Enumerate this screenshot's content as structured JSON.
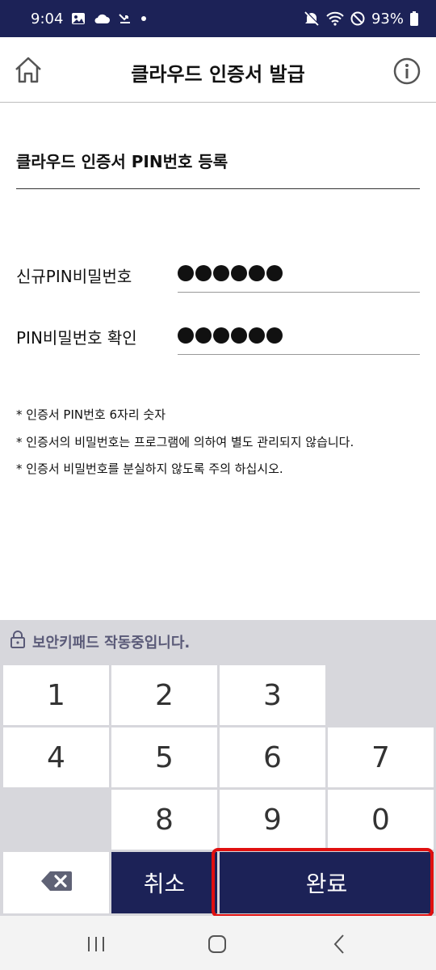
{
  "status_bar": {
    "time": "9:04",
    "battery": "93%",
    "left_icons": [
      "image-icon",
      "cloud-icon",
      "missed-call-icon",
      "dot-icon"
    ],
    "right_icons": [
      "mute-icon",
      "wifi-icon",
      "do-not-disturb-icon",
      "battery-icon"
    ]
  },
  "header": {
    "title": "클라우드 인증서 발급",
    "left_icon": "home-icon",
    "right_icon": "info-icon"
  },
  "section": {
    "title": "클라우드 인증서 PIN번호 등록"
  },
  "form": {
    "new_pin_label": "신규PIN비밀번호",
    "new_pin_dots": 6,
    "confirm_pin_label": "PIN비밀번호 확인",
    "confirm_pin_dots": 6
  },
  "notes": [
    "* 인증서 PIN번호 6자리 숫자",
    "* 인증서의 비밀번호는 프로그램에 의하여 별도 관리되지 않습니다.",
    "* 인증서 비밀번호를 분실하지 않도록 주의 하십시오."
  ],
  "keypad": {
    "header": "보안키패드 작동중입니다.",
    "header_icon": "lock-icon",
    "keys": {
      "k1": "1",
      "k2": "2",
      "k3": "3",
      "k4": "4",
      "k5": "5",
      "k6": "6",
      "k7": "7",
      "k8": "8",
      "k9": "9",
      "k0": "0"
    },
    "backspace_icon": "backspace-icon",
    "cancel_label": "취소",
    "complete_label": "완료"
  },
  "nav_bar": {
    "icons": [
      "recent-apps-icon",
      "home-nav-icon",
      "back-icon"
    ]
  },
  "colors": {
    "brand_navy": "#1c2257",
    "highlight_red": "#e01010",
    "keypad_bg": "#d7d7dc"
  }
}
